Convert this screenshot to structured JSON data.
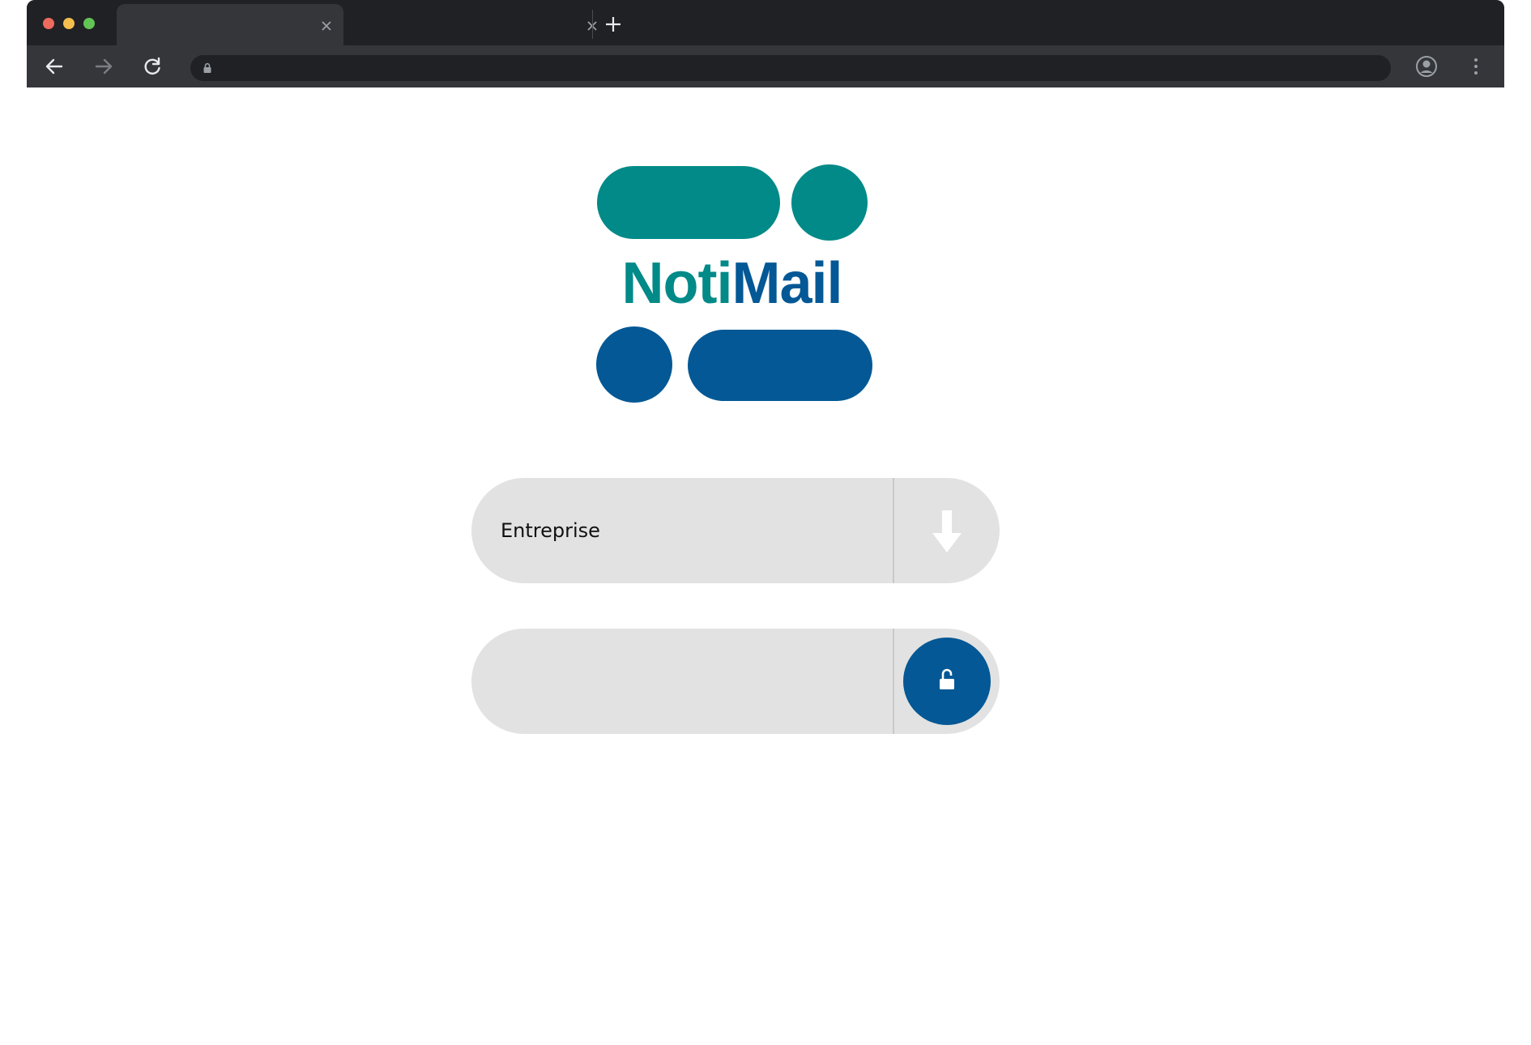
{
  "browser": {
    "tabs": [
      {
        "title": "",
        "active": true
      },
      {
        "title": "",
        "active": false
      }
    ],
    "address_bar": {
      "value": ""
    },
    "icons": {
      "back": "back-arrow-icon",
      "forward": "forward-arrow-icon",
      "reload": "reload-icon",
      "lock": "lock-icon",
      "profile": "profile-icon",
      "menu": "more-vertical-icon",
      "new_tab": "plus-icon",
      "close_tab": "close-icon"
    }
  },
  "logo": {
    "word_part1": "Noti",
    "word_part2": "Mail",
    "colors": {
      "teal": "#018a88",
      "blue": "#035895"
    }
  },
  "form": {
    "company": {
      "value": "Entreprise",
      "icon": "arrow-down-icon"
    },
    "password": {
      "value": "",
      "icon": "unlock-icon"
    }
  }
}
